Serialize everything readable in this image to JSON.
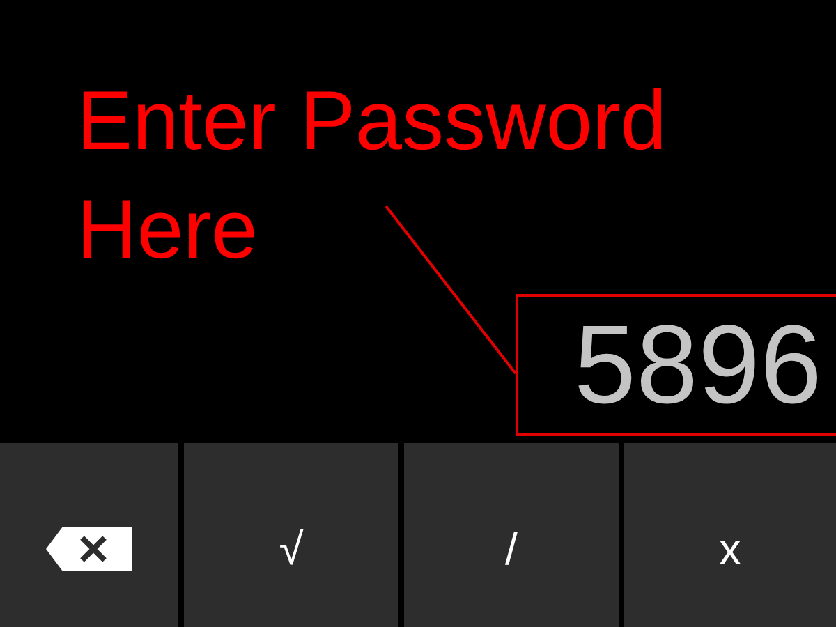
{
  "annotation": {
    "text": "Enter Password Here"
  },
  "password_field": {
    "value": "5896"
  },
  "keys": [
    {
      "kind": "backspace"
    },
    {
      "kind": "char",
      "label": "√"
    },
    {
      "kind": "char",
      "label": "/"
    },
    {
      "kind": "char",
      "label": "x"
    }
  ]
}
